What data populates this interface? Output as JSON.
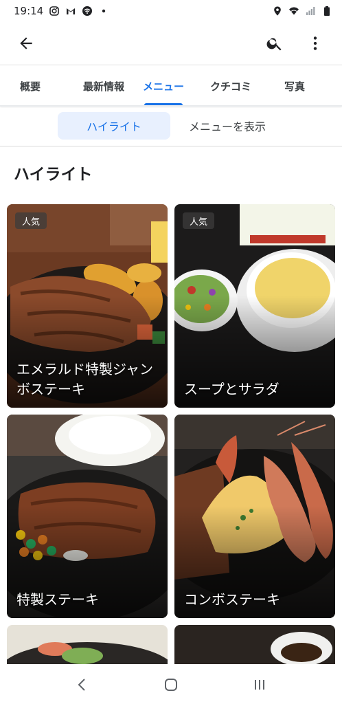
{
  "status_bar": {
    "time": "19:14",
    "left_icons": [
      "instagram-icon",
      "gmail-icon",
      "wifi-icon",
      "dot-icon"
    ],
    "right_icons": [
      "location-icon",
      "wifi-signal-icon",
      "cell-signal-icon",
      "battery-icon"
    ]
  },
  "app_bar": {
    "back_icon": "arrow-back-icon",
    "search_icon": "search-icon",
    "more_icon": "more-vert-icon"
  },
  "tabs": [
    {
      "label": "概要",
      "active": false
    },
    {
      "label": "最新情報",
      "active": false
    },
    {
      "label": "メニュー",
      "active": true
    },
    {
      "label": "クチコミ",
      "active": false
    },
    {
      "label": "写真",
      "active": false
    }
  ],
  "sub_toggle": {
    "selected": "ハイライト",
    "other": "メニューを表示"
  },
  "section": {
    "title": "ハイライト"
  },
  "menu_items": [
    {
      "name": "エメラルド特製ジャンボステーキ",
      "badge": "人気"
    },
    {
      "name": "スープとサラダ",
      "badge": "人気"
    },
    {
      "name": "特製ステーキ",
      "badge": ""
    },
    {
      "name": "コンボステーキ",
      "badge": ""
    }
  ],
  "nav_bar": {
    "icons": [
      "nav-back-icon",
      "nav-home-icon",
      "nav-recents-icon"
    ]
  },
  "colors": {
    "accent": "#1a73e8",
    "chip_bg": "#e8f0fe",
    "text": "#202124"
  }
}
